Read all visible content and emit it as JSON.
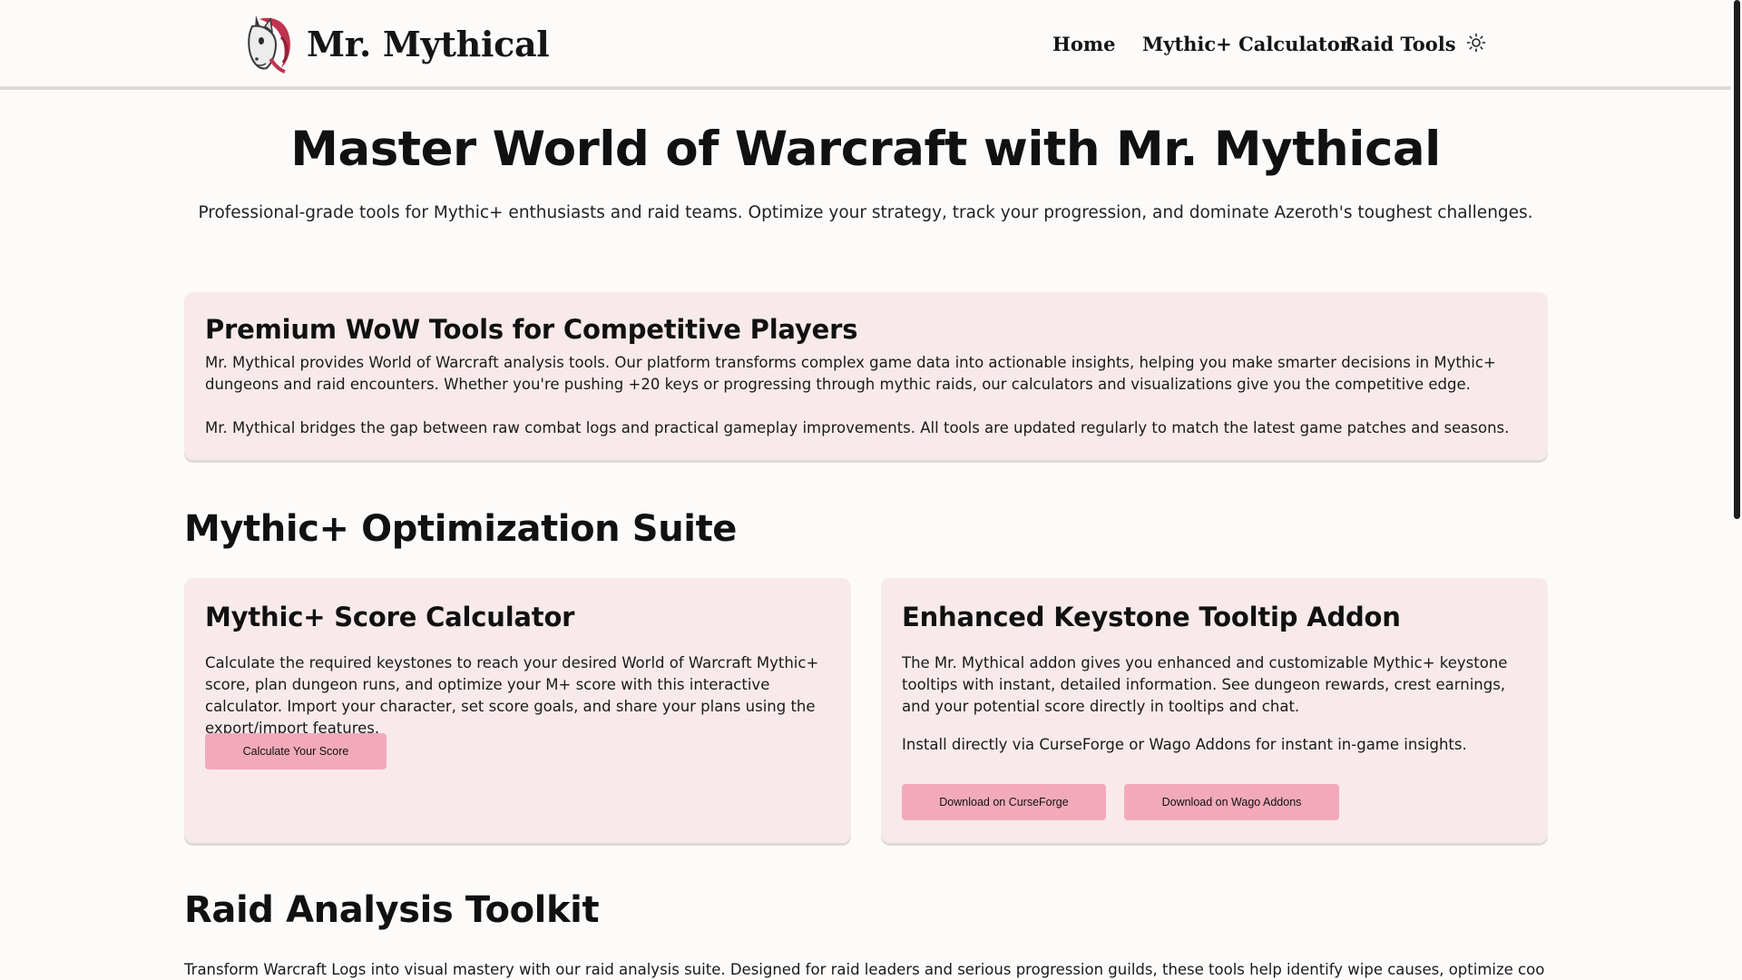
{
  "header": {
    "brand_name": "Mr. Mythical",
    "nav": {
      "home": "Home",
      "calculator": "Mythic+ Calculator",
      "raid_tools": "Raid Tools"
    },
    "theme_icon": "sun-icon"
  },
  "hero": {
    "title": "Master World of Warcraft with Mr. Mythical",
    "subtitle": "Professional-grade tools for Mythic+ enthusiasts and raid teams. Optimize your strategy, track your progression, and dominate Azeroth's toughest challenges."
  },
  "intro": {
    "title": "Premium WoW Tools for Competitive Players",
    "paragraph1": "Mr. Mythical provides World of Warcraft analysis tools. Our platform transforms complex game data into actionable insights, helping you make smarter decisions in Mythic+ dungeons and raid encounters. Whether you're pushing +20 keys or progressing through mythic raids, our calculators and visualizations give you the competitive edge.",
    "paragraph2": "Mr. Mythical bridges the gap between raw combat logs and practical gameplay improvements. All tools are updated regularly to match the latest game patches and seasons."
  },
  "mythic_section": {
    "title": "Mythic+ Optimization Suite",
    "calculator": {
      "title": "Mythic+ Score Calculator",
      "text": "Calculate the required keystones to reach your desired World of Warcraft Mythic+ score, plan dungeon runs, and optimize your M+ score with this interactive calculator. Import your character, set score goals, and share your plans using the export/import features.",
      "button": "Calculate Your Score"
    },
    "addon": {
      "title": "Enhanced Keystone Tooltip Addon",
      "text1": "The Mr. Mythical addon gives you enhanced and customizable Mythic+ keystone tooltips with instant, detailed information. See dungeon rewards, crest earnings, and your potential score directly in tooltips and chat.",
      "text2": "Install directly via CurseForge or Wago Addons for instant in-game insights.",
      "button_curseforge": "Download on CurseForge",
      "button_wago": "Download on Wago Addons"
    }
  },
  "raid_section": {
    "title": "Raid Analysis Toolkit",
    "text": "Transform Warcraft Logs into visual mastery with our raid analysis suite. Designed for raid leaders and serious progression guilds, these tools help identify wipe causes, optimize cooldown usage, and"
  },
  "colors": {
    "background": "#fcfbfa",
    "card": "#f8eaea",
    "button": "#f2aabb",
    "logo_accent": "#c0334f"
  }
}
